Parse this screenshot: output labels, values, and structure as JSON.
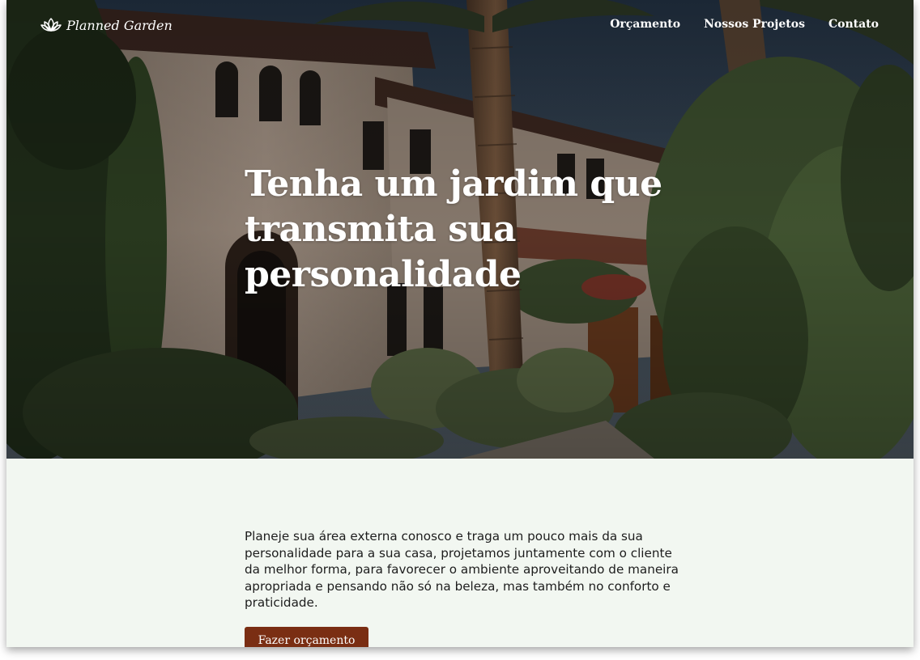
{
  "header": {
    "brand_name": "Planned Garden",
    "logo_icon": "lotus-icon",
    "nav": [
      {
        "label": "Orçamento"
      },
      {
        "label": "Nossos Projetos"
      },
      {
        "label": "Contato"
      }
    ]
  },
  "hero": {
    "headline": "Tenha um jardim que transmita sua personalidade"
  },
  "intro": {
    "text": "Planeje sua área externa conosco e traga um pouco mais da sua personalidade para a sua casa, projetamos juntamente com o cliente da melhor forma, para favorecer o ambiente aproveitando de maneira apropriada e pensando não só na beleza, mas também no conforto e praticidade.",
    "cta_label": "Fazer orçamento"
  },
  "colors": {
    "section_background": "#f2f7f1",
    "cta_background": "#7a2e13",
    "nav_text": "#ffffff"
  }
}
